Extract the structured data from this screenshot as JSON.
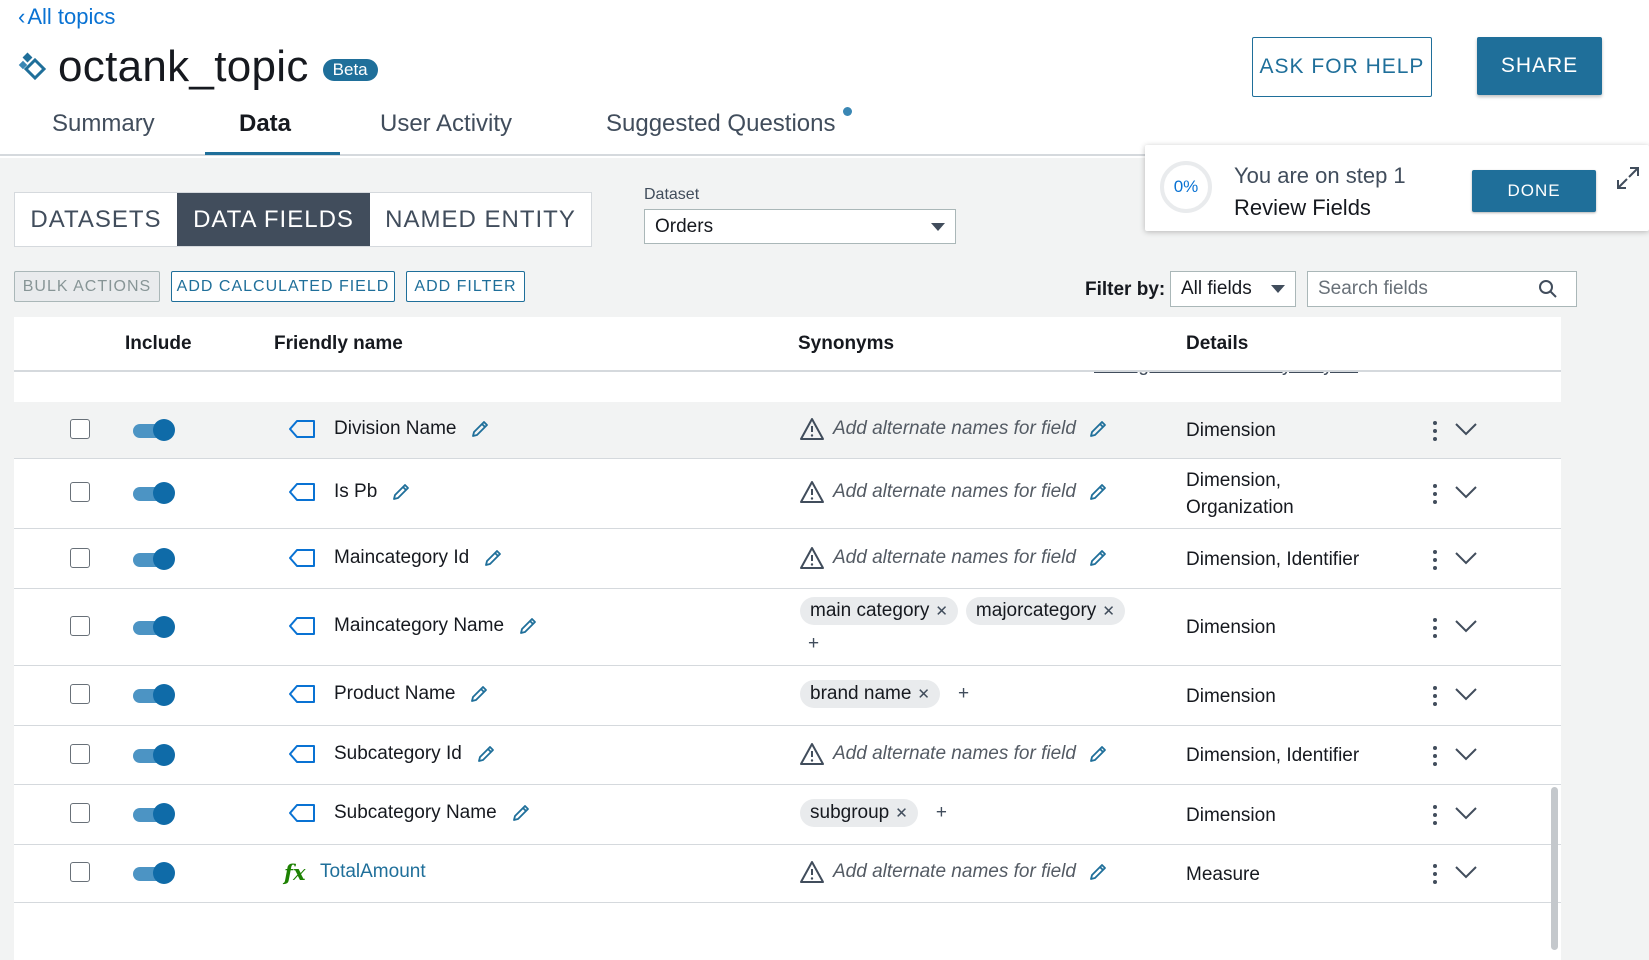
{
  "nav": {
    "back_label": "All topics"
  },
  "topic": {
    "title": "octank_topic",
    "badge": "Beta"
  },
  "header_buttons": {
    "help": "ASK FOR HELP",
    "share": "SHARE"
  },
  "tabs": [
    {
      "label": "Summary",
      "active": false
    },
    {
      "label": "Data",
      "active": true
    },
    {
      "label": "User Activity",
      "active": false
    },
    {
      "label": "Suggested Questions",
      "active": false
    }
  ],
  "segmented": [
    {
      "label": "DATASETS",
      "active": false
    },
    {
      "label": "DATA FIELDS",
      "active": true
    },
    {
      "label": "NAMED ENTITY",
      "active": false
    }
  ],
  "dataset": {
    "label": "Dataset",
    "value": "Orders"
  },
  "step": {
    "progress": "0%",
    "line1": "You are on step 1",
    "line2": "Review Fields",
    "done_label": "DONE"
  },
  "actions": {
    "bulk": "BULK ACTIONS",
    "calc": "ADD CALCULATED FIELD",
    "filter": "ADD FILTER"
  },
  "filter": {
    "label": "Filter by:",
    "value": "All fields",
    "search_placeholder": "Search fields"
  },
  "table": {
    "headers": {
      "include": "Include",
      "friendly": "Friendly name",
      "synonyms": "Synonyms",
      "details": "Details"
    },
    "cut_link": "Configure field value synonyms",
    "placeholder_synonym": "Add alternate names for field",
    "rows": [
      {
        "name": "Division Name",
        "type": "dimension",
        "synonyms": [],
        "details": [
          "Dimension"
        ]
      },
      {
        "name": "Is Pb",
        "type": "dimension",
        "synonyms": [],
        "details": [
          "Dimension,",
          "Organization"
        ]
      },
      {
        "name": "Maincategory Id",
        "type": "dimension",
        "synonyms": [],
        "details": [
          "Dimension, Identifier"
        ]
      },
      {
        "name": "Maincategory Name",
        "type": "dimension",
        "synonyms": [
          "main category",
          "majorcategory"
        ],
        "details": [
          "Dimension"
        ]
      },
      {
        "name": "Product Name",
        "type": "dimension",
        "synonyms": [
          "brand name"
        ],
        "details": [
          "Dimension"
        ]
      },
      {
        "name": "Subcategory Id",
        "type": "dimension",
        "synonyms": [],
        "details": [
          "Dimension, Identifier"
        ]
      },
      {
        "name": "Subcategory Name",
        "type": "dimension",
        "synonyms": [
          "subgroup"
        ],
        "details": [
          "Dimension"
        ]
      },
      {
        "name": "TotalAmount",
        "type": "calculated",
        "synonyms": [],
        "details": [
          "Measure"
        ]
      }
    ]
  },
  "colors": {
    "primary": "#1f6f9a",
    "link": "#0972d3",
    "toggle_on": "#0f6ba8",
    "calc_icon": "#1d8102"
  }
}
